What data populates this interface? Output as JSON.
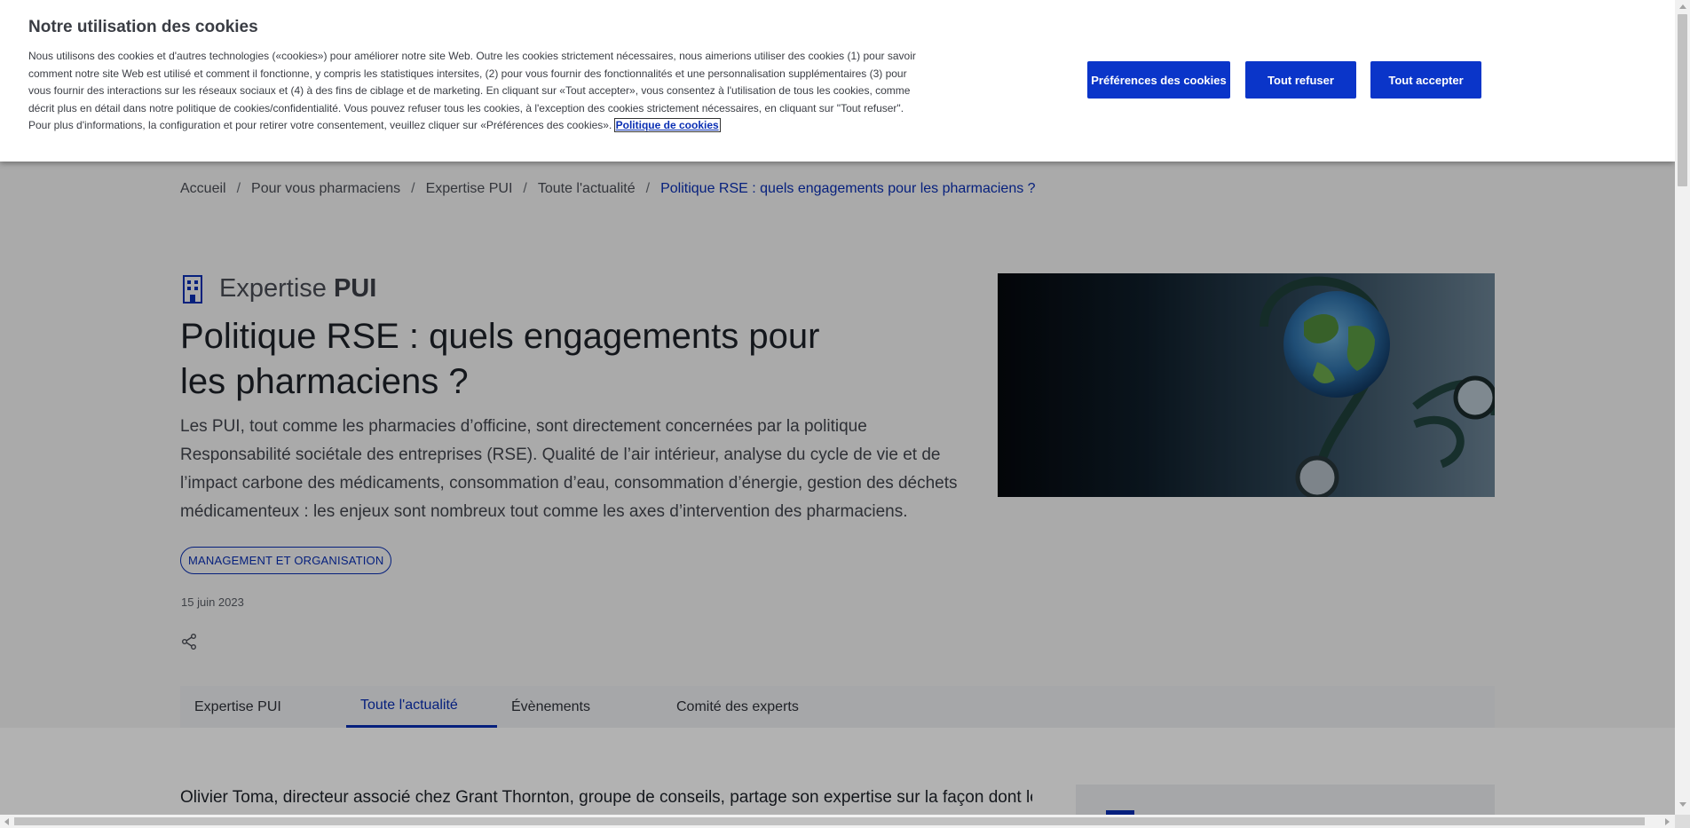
{
  "cookie_banner": {
    "title": "Notre utilisation des cookies",
    "description": "Nous utilisons des cookies et d'autres technologies («cookies») pour améliorer notre site Web. Outre les cookies strictement nécessaires, nous aimerions utiliser des cookies (1) pour savoir comment notre site Web est utilisé et comment il fonctionne, y compris les statistiques intersites, (2) pour vous fournir des fonctionnalités et une personnalisation supplémentaires (3) pour vous fournir des interactions sur les réseaux sociaux et (4) à des fins de ciblage et de marketing. En cliquant sur «Tout accepter», vous consentez à l'utilisation de tous les cookies, comme décrit plus en détail dans notre politique de cookies/confidentialité. Vous pouvez refuser tous les cookies, à l'exception des cookies strictement nécessaires, en cliquant sur \"Tout refuser\". Pour plus d'informations, la configuration et pour retirer votre consentement, veuillez cliquer sur «Préférences des cookies».",
    "policy_link": "Politique de cookies",
    "buttons": {
      "preferences": "Préférences des cookies",
      "refuse": "Tout refuser",
      "accept": "Tout accepter"
    }
  },
  "breadcrumb": {
    "items": [
      "Accueil",
      "Pour vous pharmaciens",
      "Expertise PUI",
      "Toute l'actualité",
      "Politique RSE : quels engagements pour les pharmaciens ?"
    ],
    "separator": "/"
  },
  "article": {
    "category_light": "Expertise",
    "category_bold": "PUI",
    "title": "Politique RSE : quels engagements pour les pharmaciens ?",
    "lead": "Les PUI, tout comme les pharmacies d’officine, sont directement concernées par la politique Responsabilité sociétale des entreprises (RSE). Qualité de l’air intérieur, analyse du cycle de vie et de l’impact carbone des médicaments, consommation d’eau, consommation d’énergie, gestion des déchets médicamenteux : les enjeux sont nombreux tout comme les axes d’intervention des pharmaciens.",
    "tag": "MANAGEMENT ET ORGANISATION",
    "date": "15 juin 2023",
    "share_icon": "share-icon",
    "body_start": "Olivier Toma, directeur associé chez Grant Thornton, groupe de conseils, partage son expertise sur la façon dont les"
  },
  "tabs": [
    {
      "label": "Expertise PUI",
      "active": false
    },
    {
      "label": "Toute l'actualité",
      "active": true
    },
    {
      "label": "Évènements",
      "active": false
    },
    {
      "label": "Comité des experts",
      "active": false
    }
  ],
  "colors": {
    "accent": "#0a2fb3",
    "button": "#0a35c9",
    "overlay": "rgba(0,0,0,0.30)"
  }
}
